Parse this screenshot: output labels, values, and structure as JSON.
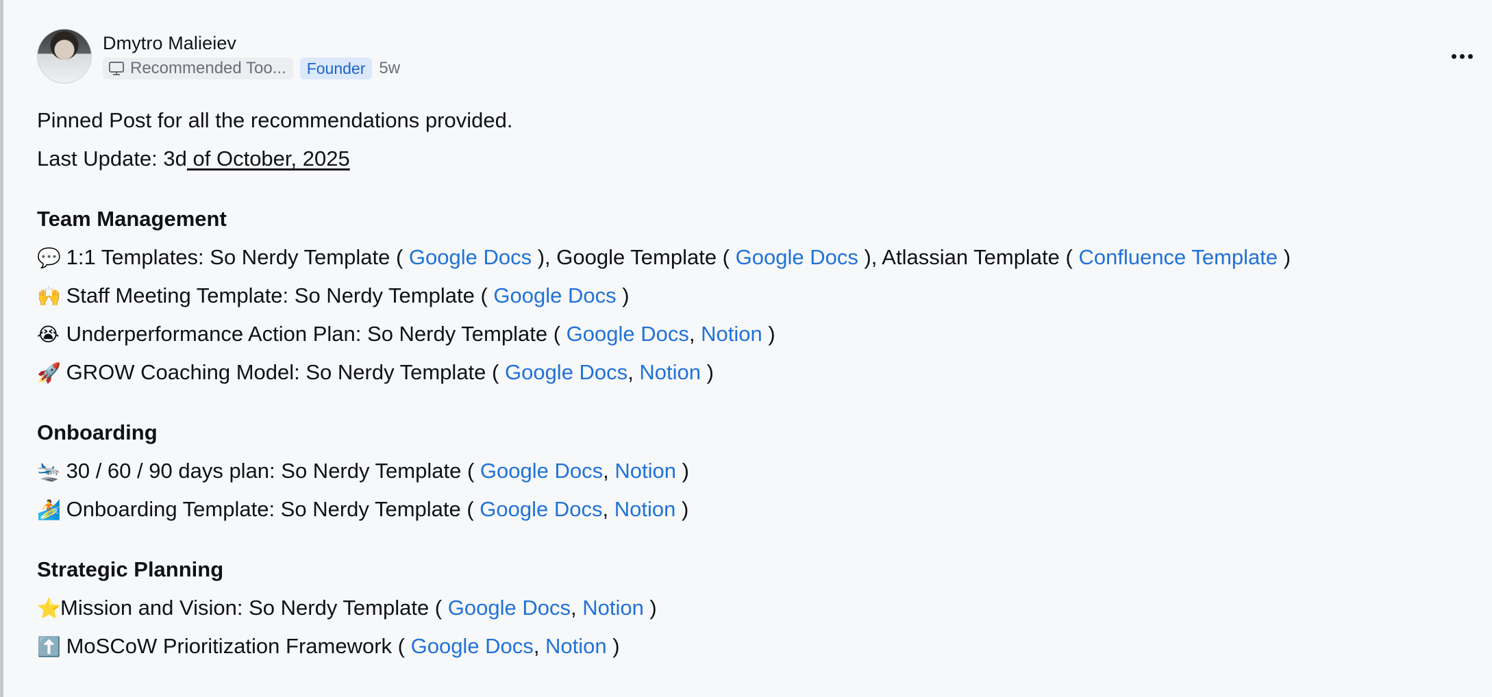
{
  "author": {
    "name": "Dmytro Malieiev",
    "space": "Recommended Too...",
    "role": "Founder",
    "age": "5w"
  },
  "intro": {
    "line1": "Pinned Post for all the recommendations provided.",
    "line2_prefix": "Last Update: 3d",
    "line2_underlined": " of October, 2025"
  },
  "sections": {
    "team": {
      "title": "Team Management",
      "items": {
        "one_on_one": {
          "emoji": "💬",
          "text_a": " 1:1 Templates: So Nerdy Template ( ",
          "link_a": "Google Docs",
          "text_b": " ), Google Template ( ",
          "link_b": "Google Docs",
          "text_c": " ), Atlassian Template ( ",
          "link_c": "Confluence Template",
          "text_d": " )"
        },
        "staff": {
          "emoji": "🙌",
          "text_a": " Staff Meeting Template: So Nerdy Template ( ",
          "link_a": "Google Docs",
          "text_b": " )"
        },
        "underperf": {
          "emoji": "😭",
          "text_a": " Underperformance Action Plan: So Nerdy Template ( ",
          "link_a": "Google Docs",
          "sep": ", ",
          "link_b": "Notion",
          "text_b": " )"
        },
        "grow": {
          "emoji": "🚀",
          "text_a": " GROW Coaching Model: So Nerdy Template ( ",
          "link_a": "Google Docs",
          "sep": ", ",
          "link_b": "Notion",
          "text_b": " )"
        }
      }
    },
    "onboarding": {
      "title": "Onboarding",
      "items": {
        "plan": {
          "emoji": "🛬",
          "text_a": " 30 / 60 / 90 days plan: So Nerdy Template ( ",
          "link_a": "Google Docs",
          "sep": ", ",
          "link_b": "Notion",
          "text_b": " )"
        },
        "template": {
          "emoji": "🏄",
          "text_a": " Onboarding Template: So Nerdy Template ( ",
          "link_a": "Google Docs",
          "sep": ", ",
          "link_b": "Notion",
          "text_b": " )"
        }
      }
    },
    "strategic": {
      "title": "Strategic Planning",
      "items": {
        "mission": {
          "emoji": "⭐",
          "text_a": "Mission and Vision: So Nerdy Template ( ",
          "link_a": "Google Docs",
          "sep": ", ",
          "link_b": "Notion",
          "text_b": " )"
        },
        "moscow": {
          "emoji": "⬆️",
          "text_a": " MoSCoW Prioritization Framework ( ",
          "link_a": "Google Docs",
          "sep": ", ",
          "link_b": "Notion",
          "text_b": " )"
        }
      }
    }
  },
  "colors": {
    "link": "#1f72d8",
    "badge_bg": "#dce9fb",
    "badge_text": "#1e64c8",
    "background": "#f7f8f9"
  },
  "icons": {
    "space": "monitor-icon",
    "menu": "more-horizontal-icon"
  }
}
